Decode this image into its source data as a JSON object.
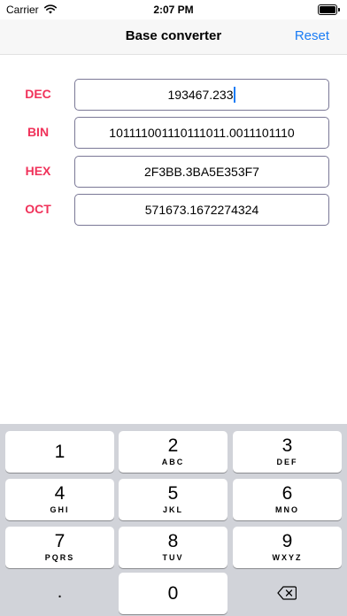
{
  "status_bar": {
    "carrier": "Carrier",
    "time": "2:07 PM",
    "wifi_icon": "wifi-icon",
    "battery_icon": "battery-icon"
  },
  "nav": {
    "title": "Base converter",
    "reset_label": "Reset"
  },
  "converter": {
    "rows": [
      {
        "label": "DEC",
        "value": "193467.233"
      },
      {
        "label": "BIN",
        "value": "101111001110111011.0011101110"
      },
      {
        "label": "HEX",
        "value": "2F3BB.3BA5E353F7"
      },
      {
        "label": "OCT",
        "value": "571673.1672274324"
      }
    ]
  },
  "colors": {
    "label": "#f0325a",
    "accent": "#1a7cf5",
    "keyboard_bg": "#d1d3d9"
  },
  "keyboard": {
    "keys": [
      {
        "digit": "1",
        "letters": ""
      },
      {
        "digit": "2",
        "letters": "ABC"
      },
      {
        "digit": "3",
        "letters": "DEF"
      },
      {
        "digit": "4",
        "letters": "GHI"
      },
      {
        "digit": "5",
        "letters": "JKL"
      },
      {
        "digit": "6",
        "letters": "MNO"
      },
      {
        "digit": "7",
        "letters": "PQRS"
      },
      {
        "digit": "8",
        "letters": "TUV"
      },
      {
        "digit": "9",
        "letters": "WXYZ"
      }
    ],
    "decimal": ".",
    "zero": "0",
    "backspace_icon": "backspace-icon"
  }
}
